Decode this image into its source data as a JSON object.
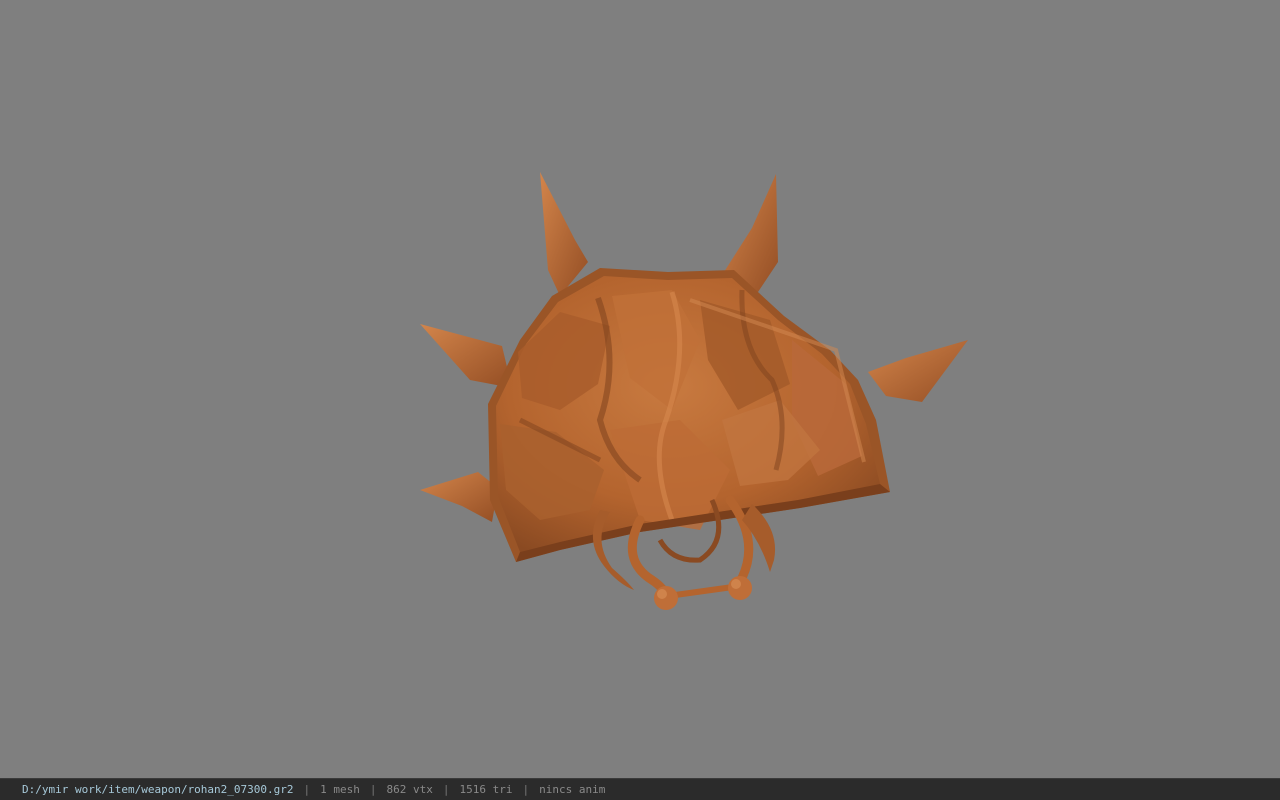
{
  "viewport": {
    "background_color": "#7f7f7f",
    "model_color": "#b4642e",
    "model_shadow_color": "#8a4a22",
    "model_highlight_color": "#cf7f45"
  },
  "status_bar": {
    "file_path": "D:/ymir work/item/weapon/rohan2_07300.gr2",
    "separator": "|",
    "mesh_count": "1 mesh",
    "vertex_count": "862 vtx",
    "triangle_count": "1516 tri",
    "animation": "nincs anim"
  }
}
